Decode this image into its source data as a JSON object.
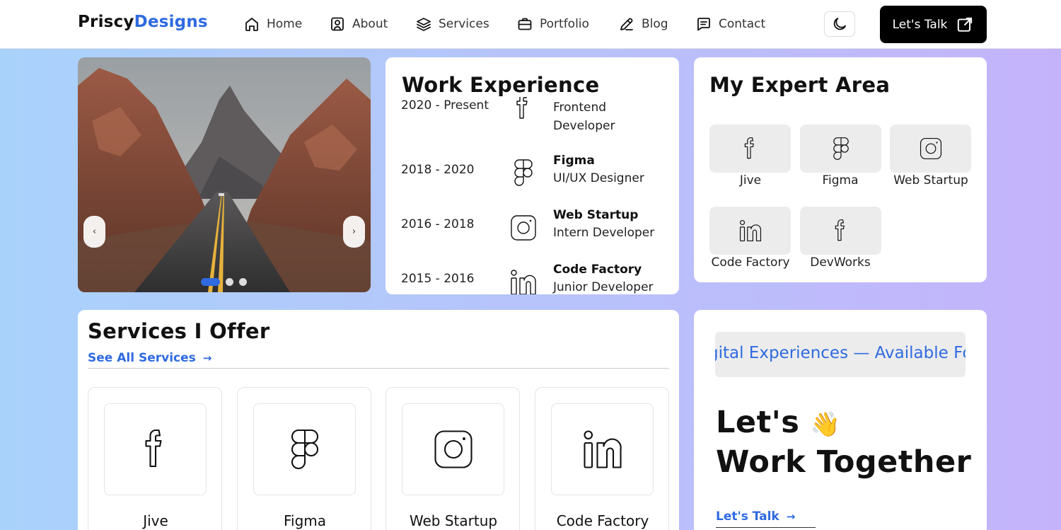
{
  "brand": {
    "part1": "Priscy",
    "part2": "Designs"
  },
  "nav": [
    {
      "label": "Home",
      "icon": "home-icon"
    },
    {
      "label": "About",
      "icon": "user-square-icon"
    },
    {
      "label": "Services",
      "icon": "layers-icon"
    },
    {
      "label": "Portfolio",
      "icon": "briefcase-icon"
    },
    {
      "label": "Blog",
      "icon": "pen-icon"
    },
    {
      "label": "Contact",
      "icon": "chat-icon"
    }
  ],
  "header": {
    "theme_toggle_icon": "moon-icon",
    "cta_label": "Let's Talk",
    "cta_icon": "external-link-icon"
  },
  "slider": {
    "prev": "‹",
    "next": "›",
    "image": "desert-road-photo",
    "dots": 3,
    "active_dot": 1
  },
  "work": {
    "title": "Work Experience",
    "items": [
      {
        "date": "2020 - Present",
        "company": "",
        "role": "Frontend Developer",
        "icon": "facebook-icon"
      },
      {
        "date": "2018 - 2020",
        "company": "Figma",
        "role": "UI/UX Designer",
        "icon": "figma-icon"
      },
      {
        "date": "2016 - 2018",
        "company": "Web Startup",
        "role": "Intern Developer",
        "icon": "instagram-icon"
      },
      {
        "date": "2015 - 2016",
        "company": "Code Factory",
        "role": "Junior Developer",
        "icon": "linkedin-icon"
      }
    ]
  },
  "expert": {
    "title": "My Expert Area",
    "items": [
      {
        "label": "Jive",
        "icon": "facebook-icon"
      },
      {
        "label": "Figma",
        "icon": "figma-icon"
      },
      {
        "label": "Web Startup",
        "icon": "instagram-icon"
      },
      {
        "label": "Code Factory",
        "icon": "linkedin-icon"
      },
      {
        "label": "DevWorks",
        "icon": "facebook-icon"
      }
    ]
  },
  "services": {
    "title": "Services I Offer",
    "see_all": "See All Services",
    "items": [
      {
        "label": "Jive",
        "icon": "facebook-icon"
      },
      {
        "label": "Figma",
        "icon": "figma-icon"
      },
      {
        "label": "Web Startup",
        "icon": "instagram-icon"
      },
      {
        "label": "Code Factory",
        "icon": "linkedin-icon"
      }
    ]
  },
  "cta": {
    "marquee": "gital Experiences — Available For Hi",
    "line1": "Let's",
    "emoji": "👋",
    "line2": "Work Together",
    "link": "Let's Talk"
  },
  "colors": {
    "accent": "#2f6ae0",
    "dark": "#000000",
    "tile": "#ececec"
  }
}
